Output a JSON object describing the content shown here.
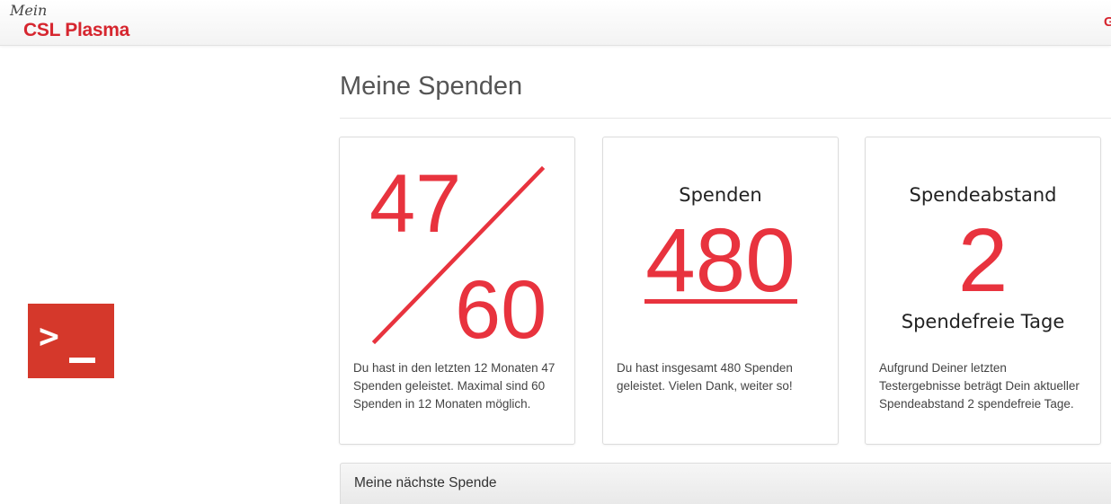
{
  "header": {
    "logo_prefix": "Mein",
    "logo_brand": "CSL Plasma",
    "right_glyph": "G",
    "brand_color": "#d6262f"
  },
  "sidebar": {
    "app_icon": "terminal-prompt-icon",
    "app_icon_glyph": ">",
    "app_icon_color": "#d5382b"
  },
  "main": {
    "title": "Meine Spenden",
    "cards": [
      {
        "numerator": "47",
        "denominator": "60",
        "description": "Du hast in den letzten 12 Monaten 47 Spenden geleistet. Maximal sind 60 Spenden in 12 Monaten möglich."
      },
      {
        "heading": "Spenden",
        "value": "480",
        "description": "Du hast insgesamt 480 Spenden geleistet. Vielen Dank, weiter so!"
      },
      {
        "heading": "Spendeabstand",
        "value": "2",
        "subheading": "Spendefreie Tage",
        "description": "Aufgrund Deiner letzten Testergebnisse beträgt Dein aktueller Spendeabstand 2 spendefreie Tage."
      }
    ],
    "next_donation_panel": {
      "title": "Meine nächste Spende"
    },
    "accent_color": "#e8333e"
  }
}
